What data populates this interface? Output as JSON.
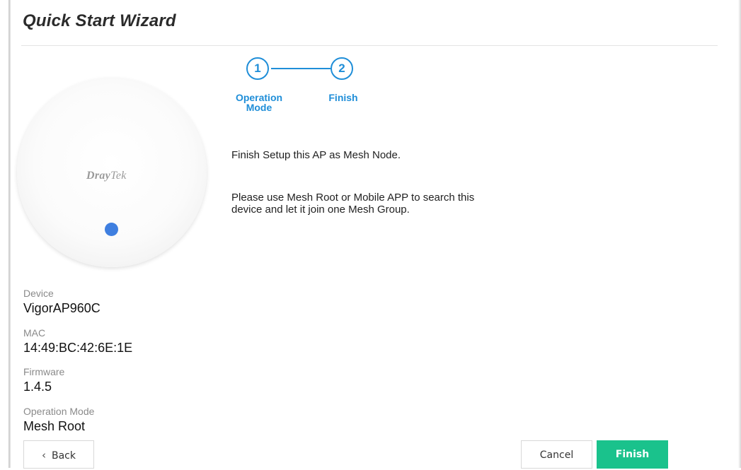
{
  "wizard": {
    "title": "Quick Start Wizard"
  },
  "stepper": {
    "steps": [
      {
        "number": "1",
        "label_line1": "Operation",
        "label_line2": "Mode"
      },
      {
        "number": "2",
        "label_line1": "Finish",
        "label_line2": ""
      }
    ],
    "accent_color": "#1f8ed8"
  },
  "device_image": {
    "logo_brand_part1": "Dray",
    "logo_brand_part2": "Tek",
    "led_color": "#3f7fe0"
  },
  "device_info": {
    "device_label": "Device",
    "device_value": "VigorAP960C",
    "mac_label": "MAC",
    "mac_value": "14:49:BC:42:6E:1E",
    "firmware_label": "Firmware",
    "firmware_value": "1.4.5",
    "operation_mode_label": "Operation Mode",
    "operation_mode_value": "Mesh Root"
  },
  "message": {
    "line1": "Finish Setup this AP as Mesh Node.",
    "line2a": "Please use Mesh Root or Mobile APP to search this",
    "line2b": "device and let it join one Mesh Group."
  },
  "buttons": {
    "back_label": "Back",
    "back_icon": "chevron-left-icon",
    "cancel_label": "Cancel",
    "finish_label": "Finish",
    "finish_color": "#1ac28c"
  }
}
